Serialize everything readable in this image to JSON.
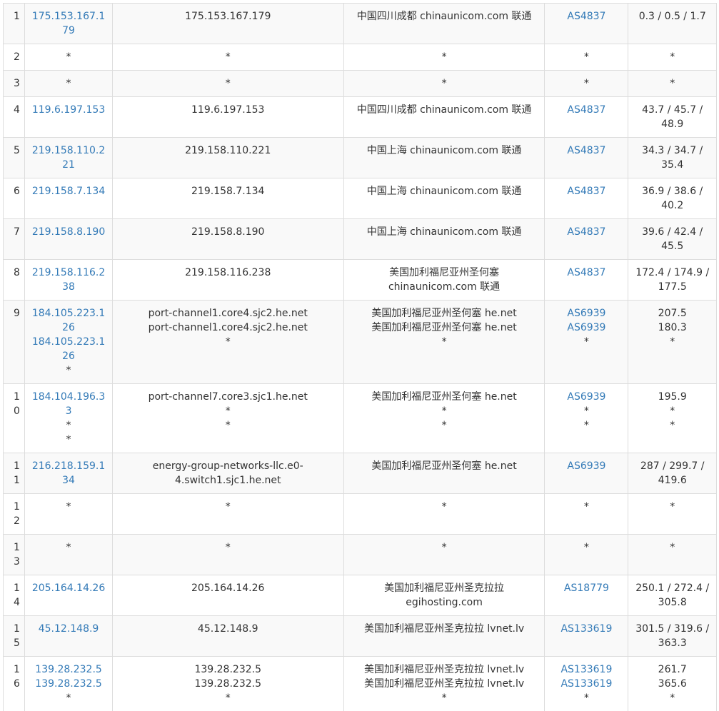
{
  "hops": [
    {
      "hop": "1",
      "ip": [
        "175.153.167.179"
      ],
      "host": [
        "175.153.167.179"
      ],
      "geo": [
        "中国四川成都 chinaunicom.com 联通"
      ],
      "asn": [
        "AS4837"
      ],
      "rtt": [
        "0.3 / 0.5 / 1.7"
      ]
    },
    {
      "hop": "2",
      "ip": [
        "*"
      ],
      "host": [
        "*"
      ],
      "geo": [
        "*"
      ],
      "asn": [
        "*"
      ],
      "rtt": [
        "*"
      ]
    },
    {
      "hop": "3",
      "ip": [
        "*"
      ],
      "host": [
        "*"
      ],
      "geo": [
        "*"
      ],
      "asn": [
        "*"
      ],
      "rtt": [
        "*"
      ]
    },
    {
      "hop": "4",
      "ip": [
        "119.6.197.153"
      ],
      "host": [
        "119.6.197.153"
      ],
      "geo": [
        "中国四川成都 chinaunicom.com 联通"
      ],
      "asn": [
        "AS4837"
      ],
      "rtt": [
        "43.7 / 45.7 / 48.9"
      ]
    },
    {
      "hop": "5",
      "ip": [
        "219.158.110.221"
      ],
      "host": [
        "219.158.110.221"
      ],
      "geo": [
        "中国上海 chinaunicom.com 联通"
      ],
      "asn": [
        "AS4837"
      ],
      "rtt": [
        "34.3 / 34.7 / 35.4"
      ]
    },
    {
      "hop": "6",
      "ip": [
        "219.158.7.134"
      ],
      "host": [
        "219.158.7.134"
      ],
      "geo": [
        "中国上海 chinaunicom.com 联通"
      ],
      "asn": [
        "AS4837"
      ],
      "rtt": [
        "36.9 / 38.6 / 40.2"
      ]
    },
    {
      "hop": "7",
      "ip": [
        "219.158.8.190"
      ],
      "host": [
        "219.158.8.190"
      ],
      "geo": [
        "中国上海 chinaunicom.com 联通"
      ],
      "asn": [
        "AS4837"
      ],
      "rtt": [
        "39.6 / 42.4 / 45.5"
      ]
    },
    {
      "hop": "8",
      "ip": [
        "219.158.116.238"
      ],
      "host": [
        "219.158.116.238"
      ],
      "geo": [
        "美国加利福尼亚州圣何塞 chinaunicom.com 联通"
      ],
      "asn": [
        "AS4837"
      ],
      "rtt": [
        "172.4 / 174.9 / 177.5"
      ]
    },
    {
      "hop": "9",
      "ip": [
        "184.105.223.126",
        "184.105.223.126",
        "*"
      ],
      "host": [
        "port-channel1.core4.sjc2.he.net",
        "port-channel1.core4.sjc2.he.net",
        "*"
      ],
      "geo": [
        "美国加利福尼亚州圣何塞 he.net",
        "美国加利福尼亚州圣何塞 he.net",
        "*"
      ],
      "asn": [
        "AS6939",
        "AS6939",
        "*"
      ],
      "rtt": [
        "207.5",
        "180.3",
        "*"
      ]
    },
    {
      "hop": "10",
      "ip": [
        "184.104.196.33",
        "*",
        "*"
      ],
      "host": [
        "port-channel7.core3.sjc1.he.net",
        "*",
        "*"
      ],
      "geo": [
        "美国加利福尼亚州圣何塞 he.net",
        "*",
        "*"
      ],
      "asn": [
        "AS6939",
        "*",
        "*"
      ],
      "rtt": [
        "195.9",
        "*",
        "*"
      ]
    },
    {
      "hop": "11",
      "ip": [
        "216.218.159.134"
      ],
      "host": [
        "energy-group-networks-llc.e0-4.switch1.sjc1.he.net"
      ],
      "geo": [
        "美国加利福尼亚州圣何塞 he.net"
      ],
      "asn": [
        "AS6939"
      ],
      "rtt": [
        "287 / 299.7 / 419.6"
      ]
    },
    {
      "hop": "12",
      "ip": [
        "*"
      ],
      "host": [
        "*"
      ],
      "geo": [
        "*"
      ],
      "asn": [
        "*"
      ],
      "rtt": [
        "*"
      ]
    },
    {
      "hop": "13",
      "ip": [
        "*"
      ],
      "host": [
        "*"
      ],
      "geo": [
        "*"
      ],
      "asn": [
        "*"
      ],
      "rtt": [
        "*"
      ]
    },
    {
      "hop": "14",
      "ip": [
        "205.164.14.26"
      ],
      "host": [
        "205.164.14.26"
      ],
      "geo": [
        "美国加利福尼亚州圣克拉拉 egihosting.com"
      ],
      "asn": [
        "AS18779"
      ],
      "rtt": [
        "250.1 / 272.4 / 305.8"
      ]
    },
    {
      "hop": "15",
      "ip": [
        "45.12.148.9"
      ],
      "host": [
        "45.12.148.9"
      ],
      "geo": [
        "美国加利福尼亚州圣克拉拉 lvnet.lv"
      ],
      "asn": [
        "AS133619"
      ],
      "rtt": [
        "301.5 / 319.6 / 363.3"
      ]
    },
    {
      "hop": "16",
      "ip": [
        "139.28.232.5",
        "139.28.232.5",
        "*"
      ],
      "host": [
        "139.28.232.5",
        "139.28.232.5",
        "*"
      ],
      "geo": [
        "美国加利福尼亚州圣克拉拉 lvnet.lv",
        "美国加利福尼亚州圣克拉拉 lvnet.lv",
        "*"
      ],
      "asn": [
        "AS133619",
        "AS133619",
        "*"
      ],
      "rtt": [
        "261.7",
        "365.6",
        "*"
      ]
    }
  ],
  "colors": {
    "link": "#337ab7",
    "text": "#333333",
    "border": "#dddddd",
    "stripe": "#f9f9f9"
  }
}
